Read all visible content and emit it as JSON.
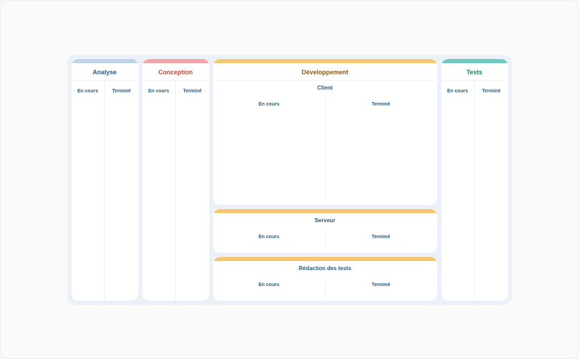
{
  "columns": {
    "analyse": {
      "title": "Analyse",
      "lanes": {
        "in_progress": "En cours",
        "done": "Terminé"
      }
    },
    "conception": {
      "title": "Conception",
      "lanes": {
        "in_progress": "En cours",
        "done": "Terminé"
      }
    },
    "development": {
      "title": "Développement",
      "sections": [
        {
          "title": "Client",
          "lanes": {
            "in_progress": "En cours",
            "done": "Terminé"
          }
        },
        {
          "title": "Serveur",
          "lanes": {
            "in_progress": "En cours",
            "done": "Terminé"
          }
        },
        {
          "title": "Rédaction des tests",
          "lanes": {
            "in_progress": "En cours",
            "done": "Terminé"
          }
        }
      ]
    },
    "tests": {
      "title": "Tests",
      "lanes": {
        "in_progress": "En cours",
        "done": "Terminé"
      }
    }
  }
}
